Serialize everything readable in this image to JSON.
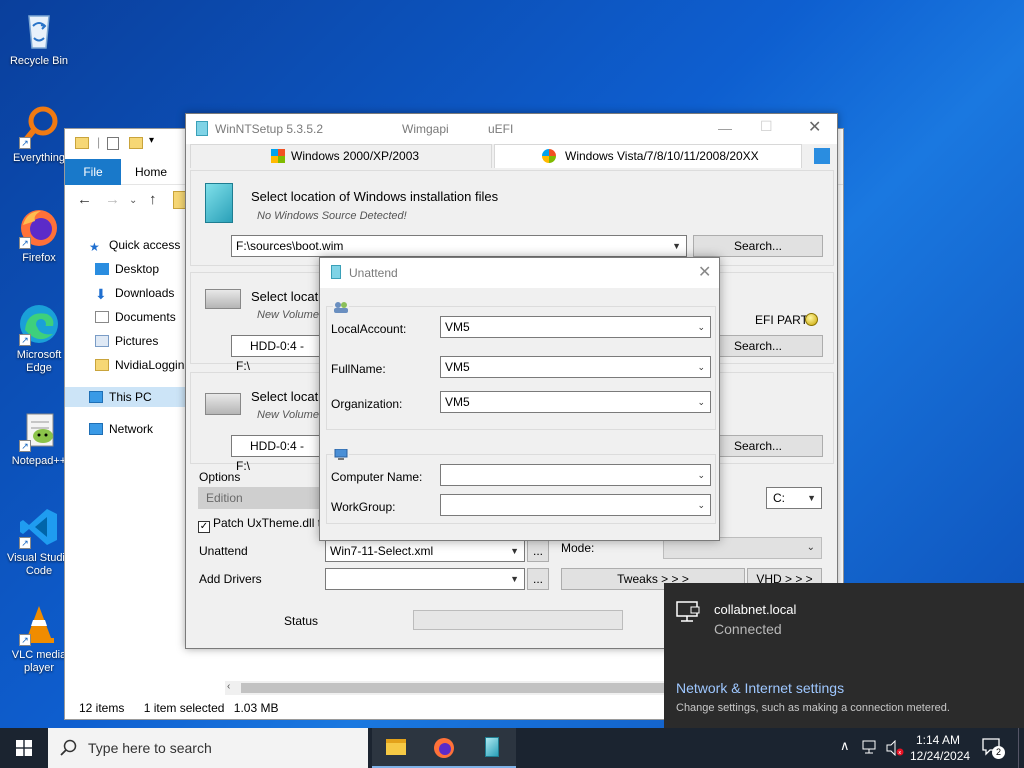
{
  "desktop": {
    "icons": [
      {
        "label": "Recycle Bin"
      },
      {
        "label": "Everything"
      },
      {
        "label": "Firefox"
      },
      {
        "label": "Microsoft Edge"
      },
      {
        "label": "Notepad++"
      },
      {
        "label": "Visual Studio Code"
      },
      {
        "label": "VLC media player"
      }
    ]
  },
  "explorer": {
    "ribbon": {
      "file": "File",
      "home": "Home"
    },
    "nav": [
      "Quick access",
      "Desktop",
      "Downloads",
      "Documents",
      "Pictures",
      "NvidiaLoggin",
      "This PC",
      "Network"
    ],
    "status": {
      "items": "12 items",
      "selected": "1 item selected",
      "size": "1.03 MB"
    }
  },
  "winntsetup": {
    "title": "WinNTSetup 5.3.5.2",
    "title_mid": "Wimgapi",
    "title_right": "uEFI",
    "tabs": [
      "Windows 2000/XP/2003",
      "Windows Vista/7/8/10/11/2008/20XX"
    ],
    "source": {
      "heading": "Select location of Windows installation files",
      "sub": "No Windows Source Detected!",
      "value": "F:\\sources\\boot.wim",
      "search": "Search..."
    },
    "boot": {
      "heading": "Select locati",
      "sub": "New Volume",
      "value": "HDD-0:4 - F:\\",
      "efi": "EFI PART",
      "search": "Search..."
    },
    "install": {
      "heading": "Select locati",
      "sub": "New Volume",
      "value": "HDD-0:4 - F:\\",
      "search": "Search..."
    },
    "options": {
      "label": "Options",
      "edition": "Edition",
      "patch": "Patch UxTheme.dll t",
      "drive": "C:",
      "unattend_label": "Unattend",
      "unattend_value": "Win7-11-Select.xml",
      "mode_label": "Mode:",
      "drivers_label": "Add Drivers",
      "ellipsis": "...",
      "tweaks": "Tweaks > > >",
      "vhd": "VHD > > >"
    },
    "status_label": "Status"
  },
  "unattend": {
    "title": "Unattend",
    "local_account": {
      "label": "LocalAccount:",
      "value": "VM5"
    },
    "full_name": {
      "label": "FullName:",
      "value": "VM5"
    },
    "organization": {
      "label": "Organization:",
      "value": "VM5"
    },
    "computer_name": {
      "label": "Computer Name:",
      "value": ""
    },
    "workgroup": {
      "label": "WorkGroup:",
      "value": ""
    }
  },
  "network_flyout": {
    "name": "collabnet.local",
    "state": "Connected",
    "settings_link": "Network & Internet settings",
    "settings_desc": "Change settings, such as making a connection metered."
  },
  "taskbar": {
    "search_placeholder": "Type here to search",
    "time": "1:14 AM",
    "date": "12/24/2024",
    "notification_count": "2"
  },
  "colors": {
    "accent": "#1979ca",
    "desktop": "#0e5fd0",
    "flyout": "#2b2b2b",
    "taskbar": "#1b2430"
  }
}
